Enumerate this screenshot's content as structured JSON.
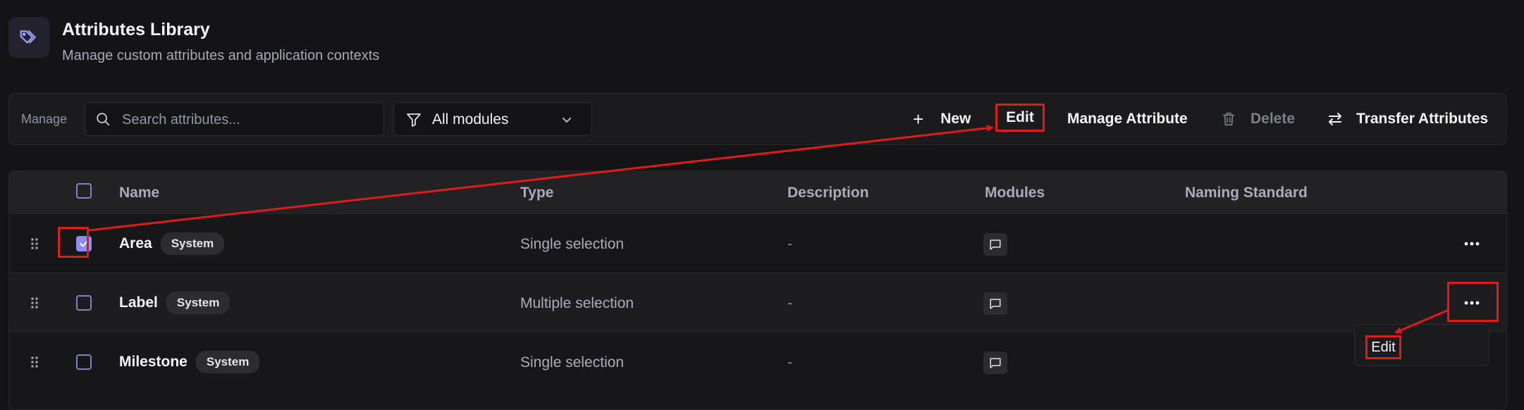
{
  "header": {
    "icon": "tag-icon",
    "title": "Attributes Library",
    "subtitle": "Manage custom attributes and application contexts"
  },
  "toolbar": {
    "manage_label": "Manage",
    "search_placeholder": "Search attributes...",
    "module_filter": "All modules",
    "new_label": "New",
    "edit_label": "Edit",
    "manage_attribute_label": "Manage Attribute",
    "delete_label": "Delete",
    "transfer_label": "Transfer Attributes"
  },
  "table": {
    "columns": [
      "Name",
      "Type",
      "Description",
      "Modules",
      "Naming Standard"
    ],
    "rows": [
      {
        "name": "Area",
        "badge": "System",
        "type": "Single selection",
        "description": "-",
        "checked": true
      },
      {
        "name": "Label",
        "badge": "System",
        "type": "Multiple selection",
        "description": "-",
        "checked": false
      },
      {
        "name": "Milestone",
        "badge": "System",
        "type": "Single selection",
        "description": "-",
        "checked": false
      }
    ]
  },
  "row_menu": {
    "items": [
      "Edit"
    ]
  },
  "colors": {
    "background": "#141416",
    "accent": "#8d8ff0",
    "annotation": "#dd1c1c"
  }
}
